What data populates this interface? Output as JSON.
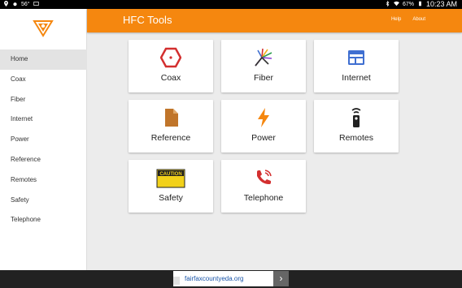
{
  "statusbar": {
    "temperature": "56°",
    "battery": "67%",
    "time": "10:23 AM"
  },
  "app": {
    "title": "HFC Tools",
    "links": [
      "Help",
      "About"
    ]
  },
  "sidebar": {
    "items": [
      {
        "label": "Home",
        "active": true
      },
      {
        "label": "Coax"
      },
      {
        "label": "Fiber"
      },
      {
        "label": "Internet"
      },
      {
        "label": "Power"
      },
      {
        "label": "Reference"
      },
      {
        "label": "Remotes"
      },
      {
        "label": "Safety"
      },
      {
        "label": "Telephone"
      }
    ]
  },
  "tiles": [
    {
      "label": "Coax",
      "icon": "coax-connector-icon"
    },
    {
      "label": "Fiber",
      "icon": "fiber-strands-icon"
    },
    {
      "label": "Internet",
      "icon": "browser-window-icon"
    },
    {
      "label": "Reference",
      "icon": "document-icon"
    },
    {
      "label": "Power",
      "icon": "lightning-bolt-icon"
    },
    {
      "label": "Remotes",
      "icon": "remote-control-icon"
    },
    {
      "label": "Safety",
      "icon": "caution-sign-icon",
      "sign_text": "CAUTION"
    },
    {
      "label": "Telephone",
      "icon": "phone-ringing-icon"
    }
  ],
  "ad": {
    "text": "fairfaxcountyeda.org",
    "arrow": "›"
  },
  "colors": {
    "accent": "#f5870f",
    "icon_red": "#d32f2f",
    "icon_blue": "#3f6fd1",
    "icon_brown": "#c0752a",
    "icon_orange": "#f5870f",
    "caution_yellow": "#f2d11a"
  }
}
